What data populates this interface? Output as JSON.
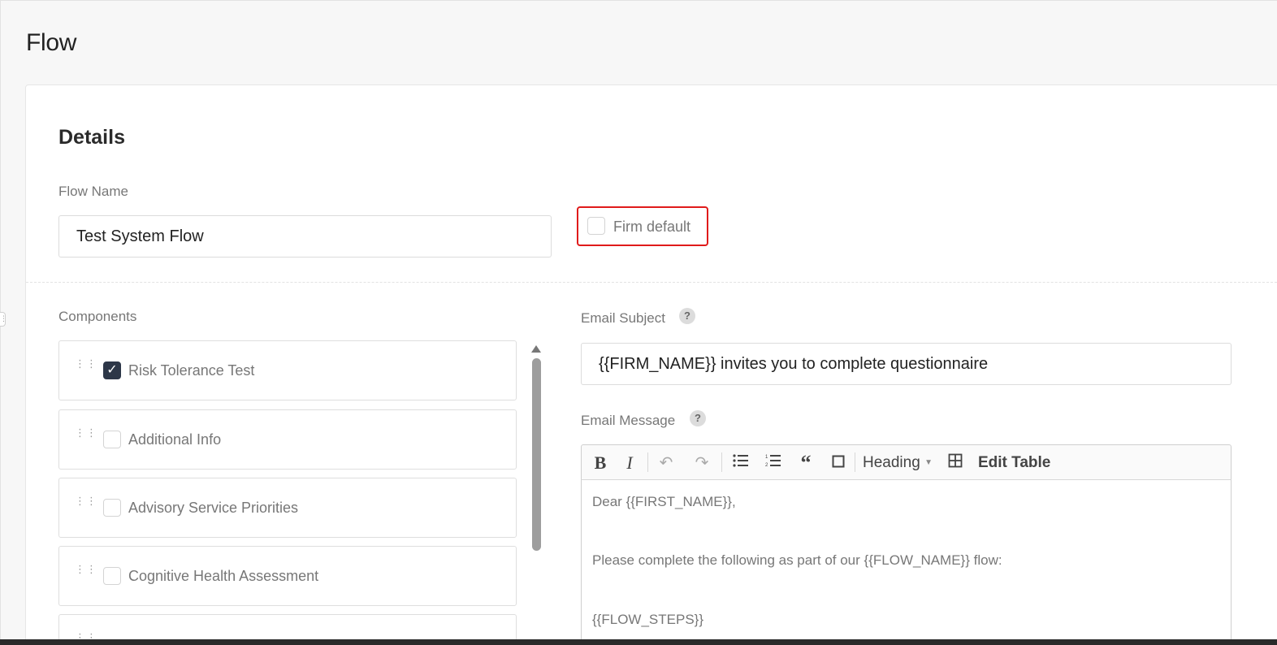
{
  "page": {
    "title": "Flow"
  },
  "details": {
    "title": "Details",
    "flow_name_label": "Flow Name",
    "flow_name_value": "Test System Flow",
    "firm_default_label": "Firm default",
    "firm_default_checked": false
  },
  "components": {
    "label": "Components",
    "items": [
      {
        "label": "Risk Tolerance Test",
        "checked": true
      },
      {
        "label": "Additional Info",
        "checked": false
      },
      {
        "label": "Advisory Service Priorities",
        "checked": false
      },
      {
        "label": "Cognitive Health Assessment",
        "checked": false
      }
    ]
  },
  "email": {
    "subject_label": "Email Subject",
    "subject_value": "{{FIRM_NAME}} invites you to complete questionnaire",
    "message_label": "Email Message",
    "help_glyph": "?",
    "toolbar": {
      "bold": "B",
      "italic": "I",
      "heading_label": "Heading",
      "edit_table_label": "Edit Table"
    },
    "message_lines": [
      "Dear {{FIRST_NAME}},",
      "Please complete the following as part of our {{FLOW_NAME}} flow:",
      "{{FLOW_STEPS}}"
    ]
  },
  "colors": {
    "highlight_border": "#e01b1b",
    "checkbox_checked": "#2d3748"
  },
  "icons": {
    "undo": "undo-icon",
    "redo": "redo-icon",
    "bullet_list": "bullet-list-icon",
    "numbered_list": "numbered-list-icon",
    "blockquote": "blockquote-icon",
    "insert_box": "insert-box-icon",
    "table": "table-icon"
  }
}
